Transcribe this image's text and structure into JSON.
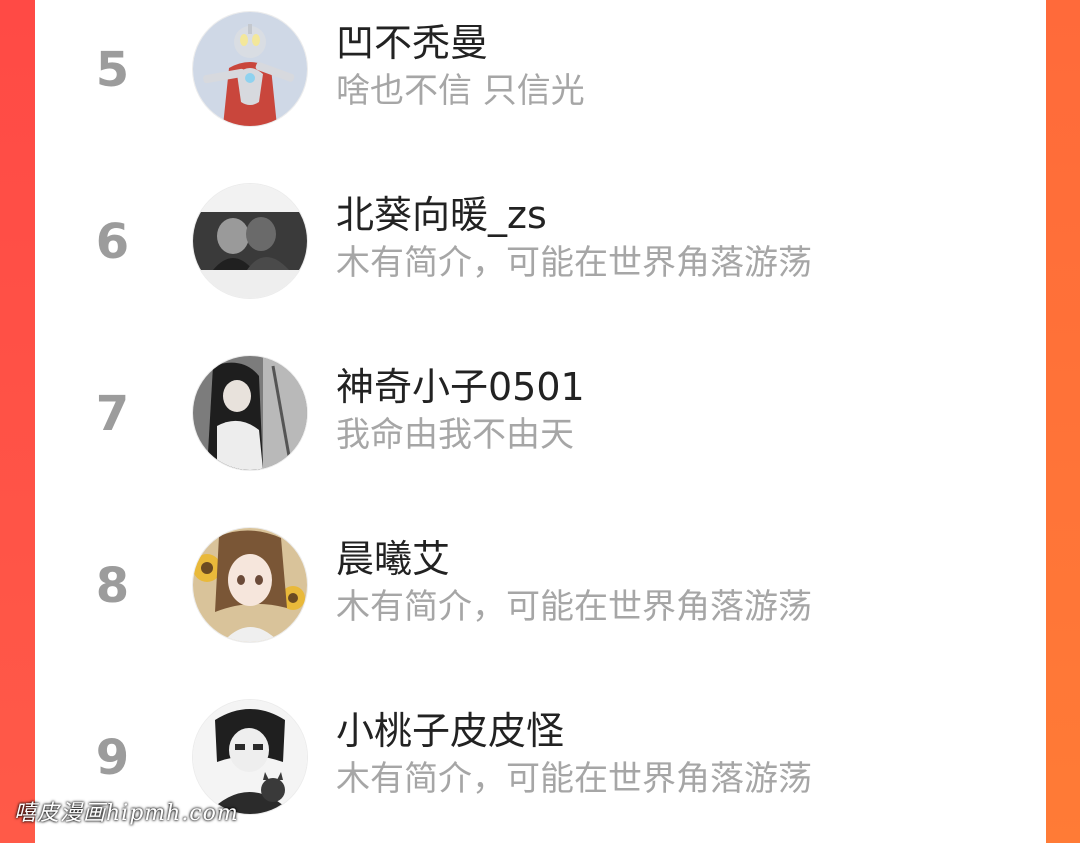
{
  "ranking_list": [
    {
      "rank": "5",
      "name": "凹不秃曼",
      "bio": "啥也不信 只信光",
      "avatar": "ultraman-avatar"
    },
    {
      "rank": "6",
      "name": "北葵向暖_zs",
      "bio": "木有简介，可能在世界角落游荡",
      "avatar": "couple-bw-avatar"
    },
    {
      "rank": "7",
      "name": "神奇小子0501",
      "bio": "我命由我不由天",
      "avatar": "anime-longhair-avatar"
    },
    {
      "rank": "8",
      "name": "晨曦艾",
      "bio": "木有简介，可能在世界角落游荡",
      "avatar": "sunflower-girl-avatar"
    },
    {
      "rank": "9",
      "name": "小桃子皮皮怪",
      "bio": "木有简介，可能在世界角落游荡",
      "avatar": "anime-boy-cat-avatar"
    }
  ],
  "watermark": "嘻皮漫画hipmh.com",
  "colors": {
    "side_left": "#ff4a45",
    "side_right": "#ff7b36",
    "rank_text": "#9c9c9c",
    "name_text": "#222222",
    "bio_text": "#a6a6a6"
  }
}
